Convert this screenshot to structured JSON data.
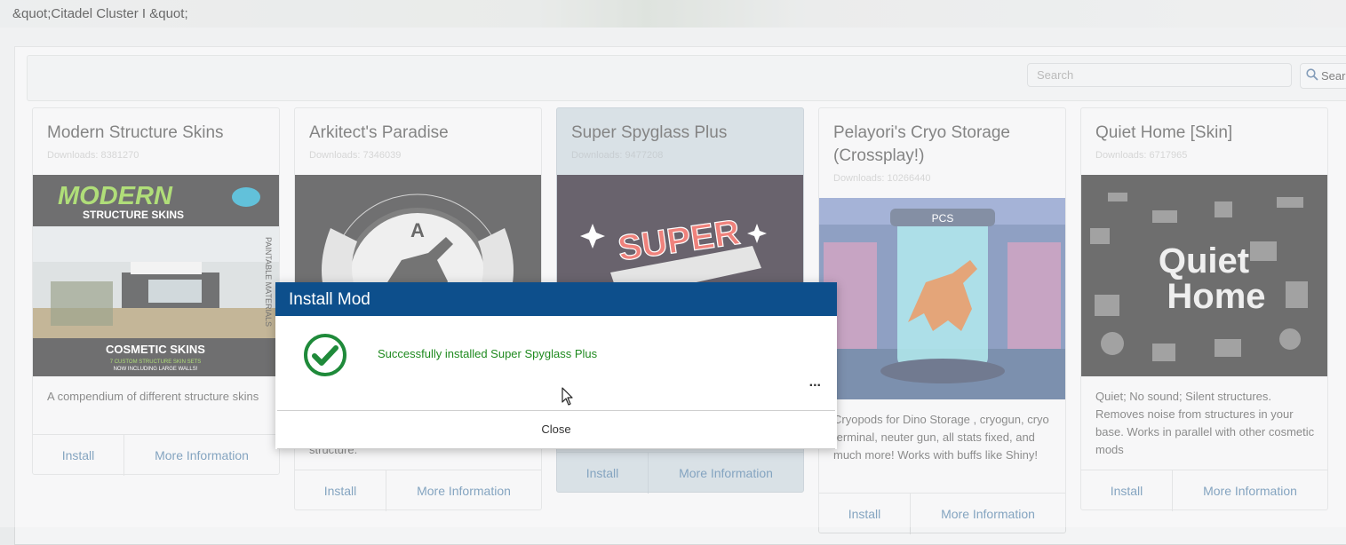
{
  "window": {
    "title": "&quot;Citadel Cluster I &quot;"
  },
  "search": {
    "placeholder": "Search",
    "button_label": "Sear"
  },
  "cards": [
    {
      "title": "Modern Structure Skins",
      "downloads": "Downloads: 8381270",
      "image_text": {
        "top": "MODERN",
        "sub": "STRUCTURE SKINS",
        "side": "PAINTABLE MATERIALS",
        "bottom": "COSMETIC SKINS",
        "bottom_sub1": "7 CUSTOM STRUCTURE SKIN SETS",
        "bottom_sub2": "NOW INCLUDING LARGE WALLS!"
      },
      "description": "A compendium of different structure skins",
      "install_label": "Install",
      "more_label": "More Information"
    },
    {
      "title": "Arkitect's Paradise",
      "downloads": "Downloads: 7346039",
      "image_text": {
        "letter": "A"
      },
      "description": "structure.",
      "install_label": "Install",
      "more_label": "More Information"
    },
    {
      "title": "Super Spyglass Plus",
      "downloads": "Downloads: 9477208",
      "image_text": {
        "word": "SUPER"
      },
      "description": "",
      "install_label": "Install",
      "more_label": "More Information"
    },
    {
      "title": "Pelayori's Cryo Storage (Crossplay!)",
      "downloads": "Downloads: 10266440",
      "image_text": {
        "sign": "PCS"
      },
      "description": "Cryopods for Dino Storage , cryogun, cryo terminal, neuter gun, all stats fixed, and much more! Works with buffs like Shiny!",
      "install_label": "Install",
      "more_label": "More Information"
    },
    {
      "title": "Quiet Home [Skin]",
      "downloads": "Downloads: 6717965",
      "image_text": {
        "line1": "Quiet",
        "line2": "Home"
      },
      "description": "Quiet; No sound; Silent structures. Removes noise from structures in your base. Works in parallel with other cosmetic mods",
      "install_label": "Install",
      "more_label": "More Information"
    }
  ],
  "modal": {
    "title": "Install Mod",
    "message": "Successfully installed Super Spyglass Plus",
    "more_glyph": "...",
    "close_label": "Close",
    "success_color": "#1f8a1f",
    "header_color": "#0d4f8c"
  },
  "icons": [
    "search-icon",
    "check-circle-icon",
    "more-options-icon",
    "mouse-cursor-icon"
  ]
}
